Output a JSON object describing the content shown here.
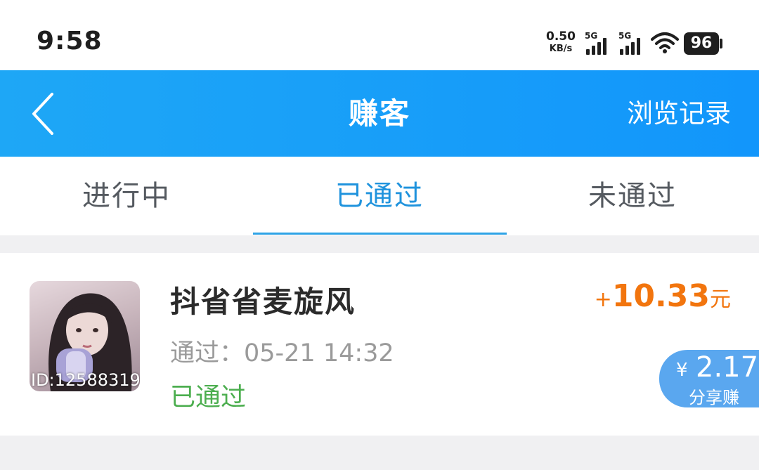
{
  "status_bar": {
    "time": "9:58",
    "net_speed_value": "0.50",
    "net_speed_unit": "KB/s",
    "sim1_label": "5G",
    "sim2_label": "5G",
    "battery": "96"
  },
  "header": {
    "back_icon": "chevron-left-icon",
    "title": "赚客",
    "history_label": "浏览记录",
    "gradient_colors": [
      "#1ea7f6",
      "#1296fb"
    ]
  },
  "tabs": {
    "items": [
      {
        "label": "进行中"
      },
      {
        "label": "已通过"
      },
      {
        "label": "未通过"
      }
    ],
    "active_index": 1,
    "active_color": "#1f93dd"
  },
  "list": {
    "items": [
      {
        "avatar_id": "ID:12588319",
        "title": "抖省省麦旋风",
        "pass_time": "通过：05-21 14:32",
        "status": "已通过",
        "reward_sign": "+",
        "reward_amount": "10.33",
        "reward_unit": "元",
        "share_currency": "¥",
        "share_amount": "2.17",
        "share_label": "分享赚"
      }
    ]
  }
}
